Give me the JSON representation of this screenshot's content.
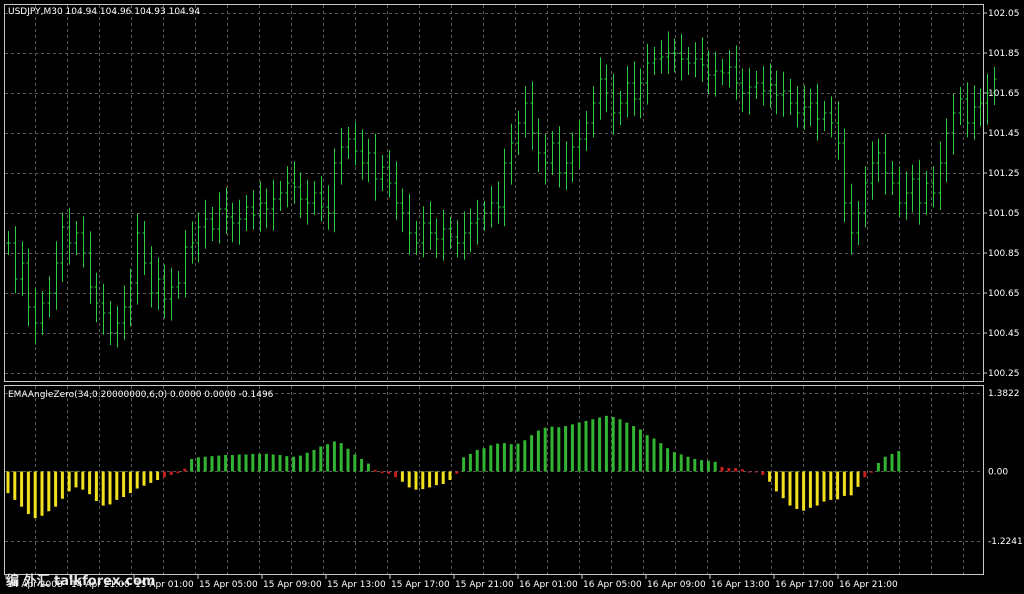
{
  "colors": {
    "background": "#000000",
    "grid": "#5a5a5a",
    "frame": "#c8c8c8",
    "bars": "#2ecc40",
    "hist_up": "#32b532",
    "hist_down": "#f0e020",
    "hist_flat": "#c81e1e",
    "text": "#ffffff"
  },
  "price_panel": {
    "title": "USDJPY,M30  104.94 104.96 104.93 104.94",
    "y_ticks": [
      "102.05",
      "101.85",
      "101.65",
      "101.45",
      "101.25",
      "101.05",
      "100.85",
      "100.65",
      "100.45",
      "100.25"
    ]
  },
  "indicator_panel": {
    "title": "EMAAngleZero(34,0.20000000,6,0) 0.0000 0.0000 -0.1496",
    "y_ticks": [
      "1.3822",
      "0.00",
      "-1.2241"
    ]
  },
  "x_ticks": [
    "14 Apr 2008",
    "14 Apr 21:00",
    "15 Apr 01:00",
    "15 Apr 05:00",
    "15 Apr 09:00",
    "15 Apr 13:00",
    "15 Apr 17:00",
    "15 Apr 21:00",
    "16 Apr 01:00",
    "16 Apr 05:00",
    "16 Apr 09:00",
    "16 Apr 13:00",
    "16 Apr 17:00",
    "16 Apr 21:00"
  ],
  "watermark": "编 外汇 talkforex.com",
  "chart_data": [
    {
      "type": "ohlc",
      "title": "USDJPY,M30  104.94 104.96 104.93 104.94",
      "ylim": [
        100.25,
        102.05
      ],
      "y_ticks": [
        102.05,
        101.85,
        101.65,
        101.45,
        101.25,
        101.05,
        100.85,
        100.65,
        100.45,
        100.25
      ],
      "grid": true,
      "series": [
        {
          "close": [
            100.9,
            100.72,
            100.8,
            100.58,
            100.5,
            100.6,
            100.65,
            100.8,
            100.98,
            100.9,
            100.95,
            100.85,
            100.68,
            100.6,
            100.55,
            100.45,
            100.5,
            100.58,
            100.7,
            100.95,
            100.8,
            100.65,
            100.72,
            100.62,
            100.68,
            100.7,
            100.88,
            100.9,
            100.98,
            101.02,
            100.97,
            101.07,
            101.03,
            101.0,
            101.02,
            101.08,
            101.04,
            101.1,
            101.07,
            101.12,
            101.15,
            101.2,
            101.18,
            101.12,
            101.1,
            101.15,
            101.08,
            101.05,
            101.3,
            101.38,
            101.42,
            101.36,
            101.3,
            101.35,
            101.22,
            101.28,
            101.2,
            101.1,
            101.05,
            100.95,
            100.9,
            101.0,
            100.95,
            100.92,
            100.97,
            100.93,
            100.9,
            100.95,
            101.0,
            101.02,
            101.05,
            101.1,
            101.08,
            101.3,
            101.4,
            101.5,
            101.6,
            101.45,
            101.35,
            101.3,
            101.4,
            101.25,
            101.3,
            101.38,
            101.42,
            101.5,
            101.6,
            101.72,
            101.65,
            101.55,
            101.6,
            101.7,
            101.62,
            101.7,
            101.8,
            101.82,
            101.83,
            101.85,
            101.85,
            101.82,
            101.8,
            101.82,
            101.79,
            101.74,
            101.76,
            101.75,
            101.78,
            101.7,
            101.65,
            101.68,
            101.7,
            101.66,
            101.69,
            101.64,
            101.66,
            101.6,
            101.55,
            101.58,
            101.6,
            101.52,
            101.55,
            101.5,
            101.4,
            101.1,
            100.95,
            101.05,
            101.2,
            101.3,
            101.35,
            101.25,
            101.2,
            101.1,
            101.15,
            101.22,
            101.1,
            101.2,
            101.15,
            101.3,
            101.45,
            101.55,
            101.62,
            101.5,
            101.58,
            101.6,
            101.65,
            101.72
          ]
        }
      ]
    },
    {
      "type": "histogram",
      "title": "EMAAngleZero(34,0.20000000,6,0) 0.0000 0.0000 -0.1496",
      "ylim": [
        -1.2241,
        1.3822
      ],
      "grid": true,
      "series": [
        {
          "name": "EMAAngleZero",
          "values": [
            -0.38,
            -0.5,
            -0.62,
            -0.75,
            -0.82,
            -0.78,
            -0.7,
            -0.62,
            -0.48,
            -0.35,
            -0.28,
            -0.32,
            -0.4,
            -0.52,
            -0.6,
            -0.58,
            -0.5,
            -0.45,
            -0.38,
            -0.3,
            -0.25,
            -0.2,
            -0.15,
            -0.1,
            -0.06,
            -0.03,
            0.05,
            0.22,
            0.25,
            0.26,
            0.27,
            0.28,
            0.29,
            0.29,
            0.3,
            0.3,
            0.31,
            0.31,
            0.31,
            0.3,
            0.29,
            0.27,
            0.26,
            0.28,
            0.33,
            0.38,
            0.44,
            0.48,
            0.53,
            0.5,
            0.4,
            0.3,
            0.22,
            0.14,
            0.03,
            -0.03,
            -0.04,
            -0.1,
            -0.18,
            -0.28,
            -0.32,
            -0.31,
            -0.28,
            -0.24,
            -0.22,
            -0.15,
            -0.04,
            0.25,
            0.31,
            0.38,
            0.41,
            0.46,
            0.49,
            0.5,
            0.48,
            0.49,
            0.55,
            0.64,
            0.72,
            0.77,
            0.79,
            0.78,
            0.8,
            0.83,
            0.86,
            0.89,
            0.92,
            0.95,
            0.98,
            0.96,
            0.92,
            0.86,
            0.8,
            0.74,
            0.64,
            0.58,
            0.5,
            0.41,
            0.34,
            0.3,
            0.26,
            0.22,
            0.2,
            0.19,
            0.17,
            0.08,
            0.06,
            0.06,
            0.04,
            0.0,
            -0.01,
            -0.06,
            -0.18,
            -0.35,
            -0.47,
            -0.6,
            -0.66,
            -0.69,
            -0.64,
            -0.6,
            -0.53,
            -0.5,
            -0.49,
            -0.43,
            -0.42,
            -0.27,
            -0.1,
            -0.02,
            0.15,
            0.26,
            0.31,
            0.36
          ]
        }
      ]
    }
  ]
}
